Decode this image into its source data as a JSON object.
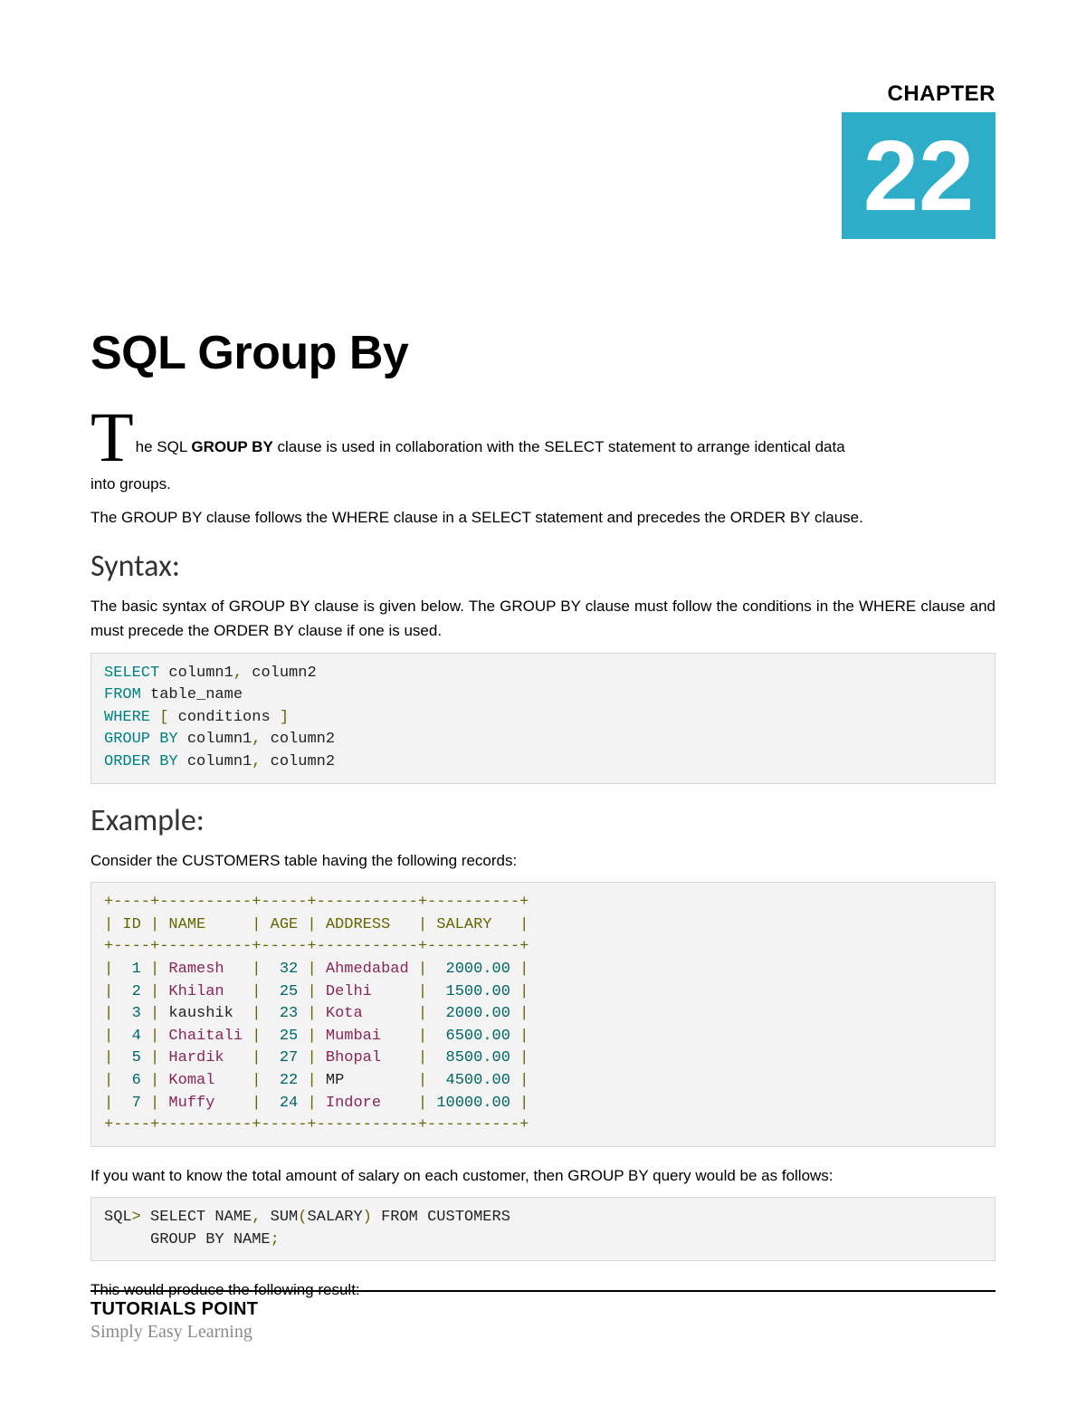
{
  "chapter": {
    "label": "CHAPTER",
    "number": "22"
  },
  "title": "SQL Group By",
  "intro": {
    "dropcap": "T",
    "line1_a": "he SQL ",
    "line1_bold": "GROUP BY",
    "line1_b": " clause is used in collaboration with the SELECT statement to arrange identical data",
    "line2": "into groups."
  },
  "para1": "The GROUP BY clause follows the WHERE clause in a SELECT statement and precedes the ORDER BY clause.",
  "syntax": {
    "heading": "Syntax:",
    "desc": "The basic syntax of GROUP BY clause is given below. The GROUP BY clause must follow the conditions in the WHERE clause and must precede the ORDER BY clause if one is used.",
    "code": {
      "l1a": "SELECT",
      "l1b": " column1",
      "l1c": ",",
      "l1d": " column2",
      "l2a": "FROM",
      "l2b": " table_name",
      "l3a": "WHERE",
      "l3b": " [",
      "l3c": " conditions ",
      "l3d": "]",
      "l4a": "GROUP BY",
      "l4b": " column1",
      "l4c": ",",
      "l4d": " column2",
      "l5a": "ORDER BY",
      "l5b": " column1",
      "l5c": ",",
      "l5d": " column2"
    }
  },
  "example": {
    "heading": "Example:",
    "desc": "Consider the CUSTOMERS table having the following records:",
    "table": {
      "border": "+----+----------+-----+-----------+----------+",
      "header": "| ID | NAME     | AGE | ADDRESS   | SALARY   |",
      "rows": [
        {
          "pipe1": "|  ",
          "id": "1",
          "pipe2": " | ",
          "name": "Ramesh  ",
          "pipe3": " |  ",
          "age": "32",
          "pipe4": " | ",
          "addr": "Ahmedabad",
          "pipe5": " |  ",
          "sal": "2000.00",
          "pipe6": " |"
        },
        {
          "pipe1": "|  ",
          "id": "2",
          "pipe2": " | ",
          "name": "Khilan  ",
          "pipe3": " |  ",
          "age": "25",
          "pipe4": " | ",
          "addr": "Delhi    ",
          "pipe5": " |  ",
          "sal": "1500.00",
          "pipe6": " |"
        },
        {
          "pipe1": "|  ",
          "id": "3",
          "pipe2": " | ",
          "name": "kaushik ",
          "pipe3": " |  ",
          "age": "23",
          "pipe4": " | ",
          "addr": "Kota     ",
          "pipe5": " |  ",
          "sal": "2000.00",
          "pipe6": " |"
        },
        {
          "pipe1": "|  ",
          "id": "4",
          "pipe2": " | ",
          "name": "Chaitali",
          "pipe3": " |  ",
          "age": "25",
          "pipe4": " | ",
          "addr": "Mumbai   ",
          "pipe5": " |  ",
          "sal": "6500.00",
          "pipe6": " |"
        },
        {
          "pipe1": "|  ",
          "id": "5",
          "pipe2": " | ",
          "name": "Hardik  ",
          "pipe3": " |  ",
          "age": "27",
          "pipe4": " | ",
          "addr": "Bhopal   ",
          "pipe5": " |  ",
          "sal": "8500.00",
          "pipe6": " |"
        },
        {
          "pipe1": "|  ",
          "id": "6",
          "pipe2": " | ",
          "name": "Komal   ",
          "pipe3": " |  ",
          "age": "22",
          "pipe4": " | ",
          "addr": "MP       ",
          "pipe5": " |  ",
          "sal": "4500.00",
          "pipe6": " |"
        },
        {
          "pipe1": "|  ",
          "id": "7",
          "pipe2": " | ",
          "name": "Muffy   ",
          "pipe3": " |  ",
          "age": "24",
          "pipe4": " | ",
          "addr": "Indore   ",
          "pipe5": " | ",
          "sal": "10000.00",
          "pipe6": " |"
        }
      ]
    },
    "para2": "If you want to know the total amount of salary on each customer, then GROUP BY query would be as follows:",
    "query": {
      "l1a": "SQL",
      "l1b": ">",
      "l1c": " SELECT NAME",
      "l1d": ",",
      "l1e": " SUM",
      "l1f": "(",
      "l1g": "SALARY",
      "l1h": ")",
      "l1i": " FROM CUSTOMERS",
      "l2a": "     GROUP BY NAME",
      "l2b": ";"
    },
    "para3": "This would produce the following result:"
  },
  "footer": {
    "title": "TUTORIALS POINT",
    "sub": "Simply Easy Learning"
  }
}
